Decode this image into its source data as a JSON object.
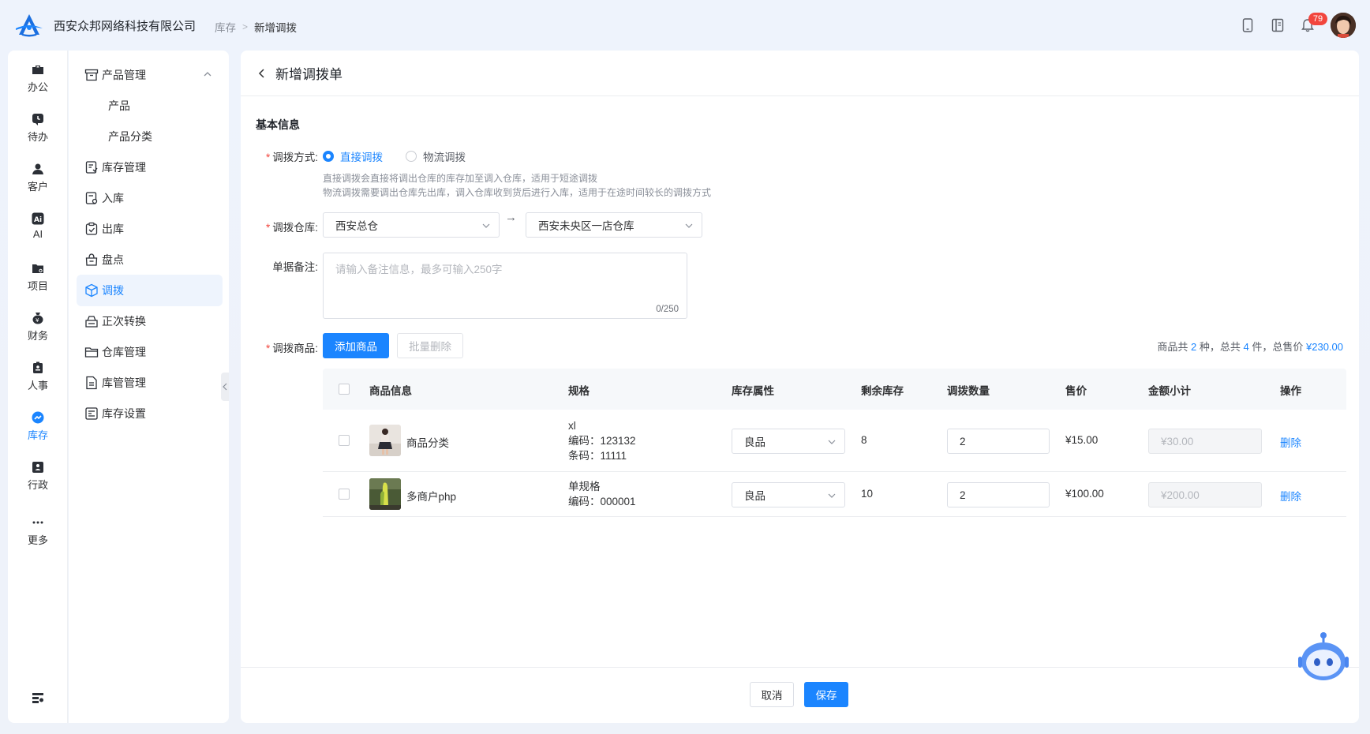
{
  "header": {
    "company": "西安众邦网络科技有限公司",
    "breadcrumb": [
      "库存",
      "新增调拨"
    ],
    "notification_count": "79"
  },
  "rail": {
    "items": [
      {
        "label": "办公",
        "icon": "briefcase-icon"
      },
      {
        "label": "待办",
        "icon": "clock-icon"
      },
      {
        "label": "客户",
        "icon": "user-icon"
      },
      {
        "label": "AI",
        "icon": "ai-icon"
      },
      {
        "label": "项目",
        "icon": "folder-icon"
      },
      {
        "label": "财务",
        "icon": "money-bag-icon"
      },
      {
        "label": "人事",
        "icon": "id-badge-icon"
      },
      {
        "label": "库存",
        "icon": "chart-icon",
        "active": true
      },
      {
        "label": "行政",
        "icon": "admin-icon"
      },
      {
        "label": "更多",
        "icon": "more-icon"
      }
    ]
  },
  "submenu": {
    "items": [
      {
        "label": "产品管理",
        "icon": "archive-icon",
        "expanded": true
      },
      {
        "label": "产品",
        "child": true
      },
      {
        "label": "产品分类",
        "child": true
      },
      {
        "label": "库存管理",
        "icon": "inventory-icon"
      },
      {
        "label": "入库",
        "icon": "stock-in-icon"
      },
      {
        "label": "出库",
        "icon": "stock-out-icon"
      },
      {
        "label": "盘点",
        "icon": "check-bag-icon"
      },
      {
        "label": "调拨",
        "icon": "cube-icon",
        "active": true
      },
      {
        "label": "正次转换",
        "icon": "convert-icon"
      },
      {
        "label": "仓库管理",
        "icon": "warehouse-icon"
      },
      {
        "label": "库管管理",
        "icon": "document-icon"
      },
      {
        "label": "库存设置",
        "icon": "settings-list-icon"
      }
    ]
  },
  "page": {
    "title": "新增调拨单",
    "section": "基本信息"
  },
  "form": {
    "method_label": "调拨方式:",
    "method_options": [
      "直接调拨",
      "物流调拨"
    ],
    "method_selected": "直接调拨",
    "hint_direct": "直接调拨会直接将调出仓库的库存加至调入仓库，适用于短途调拨",
    "hint_logistics": "物流调拨需要调出仓库先出库，调入仓库收到货后进行入库，适用于在途时间较长的调拨方式",
    "warehouse_label": "调拨仓库:",
    "from_warehouse": "西安总仓",
    "arrow": "→",
    "to_warehouse": "西安未央区一店仓库",
    "remark_label": "单据备注:",
    "remark_placeholder": "请输入备注信息，最多可输入250字",
    "remark_count": "0/250",
    "goods_label": "调拨商品:",
    "add_button": "添加商品",
    "batch_delete_button": "批量删除"
  },
  "summary": {
    "prefix": "商品共",
    "kinds": "2",
    "mid1": "种，总共",
    "pieces": "4",
    "mid2": "件，总售价",
    "total": "¥230.00"
  },
  "table": {
    "columns": [
      "商品信息",
      "规格",
      "库存属性",
      "剩余库存",
      "调拨数量",
      "售价",
      "金额小计",
      "操作"
    ],
    "rows": [
      {
        "name": "商品分类",
        "spec": [
          "xl",
          "编码：123132",
          "条码：11111"
        ],
        "attribute": "良品",
        "stock": "8",
        "qty": "2",
        "price": "¥15.00",
        "subtotal": "¥30.00",
        "action": "删除"
      },
      {
        "name": "多商户php",
        "spec": [
          "单规格",
          "编码：000001"
        ],
        "attribute": "良品",
        "stock": "10",
        "qty": "2",
        "price": "¥100.00",
        "subtotal": "¥200.00",
        "action": "删除"
      }
    ]
  },
  "footer": {
    "cancel": "取消",
    "save": "保存"
  },
  "colors": {
    "accent": "#1b85ff",
    "required": "#f2453d",
    "badge": "#f2453d"
  }
}
